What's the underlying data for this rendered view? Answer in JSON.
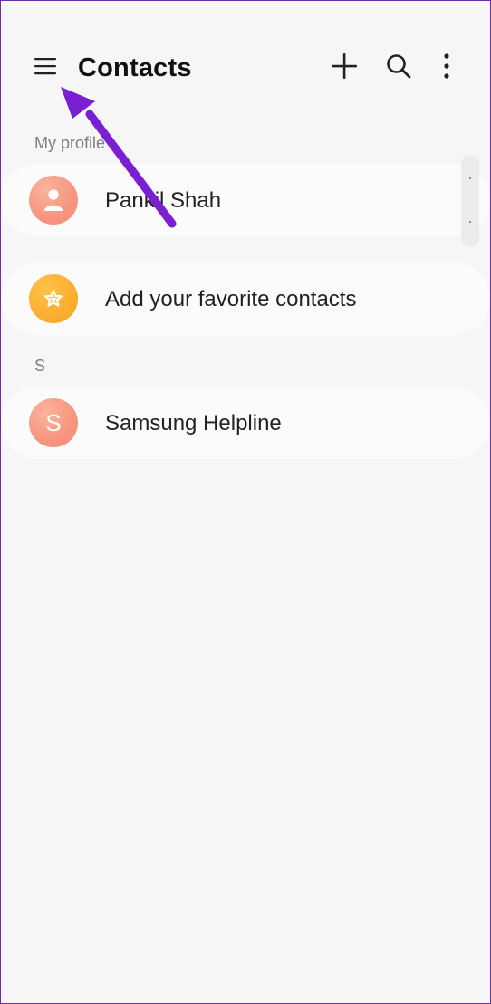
{
  "header": {
    "title": "Contacts",
    "icons": {
      "menu": "hamburger-menu-icon",
      "add": "plus-icon",
      "search": "search-icon",
      "more": "more-vertical-icon"
    }
  },
  "sections": {
    "my_profile_label": "My profile",
    "s_label": "S"
  },
  "profile": {
    "name": "Pankil Shah",
    "avatar_icon": "person-icon"
  },
  "favorites": {
    "label": "Add your favorite contacts",
    "icon": "star-icon"
  },
  "contacts": [
    {
      "name": "Samsung Helpline",
      "initial": "S"
    }
  ],
  "colors": {
    "background": "#f6f6f6",
    "card": "#fbfbfb",
    "avatar_peach": "#f6957f",
    "avatar_gold": "#f9ab2b",
    "annotation_arrow": "#7a1fd1"
  }
}
